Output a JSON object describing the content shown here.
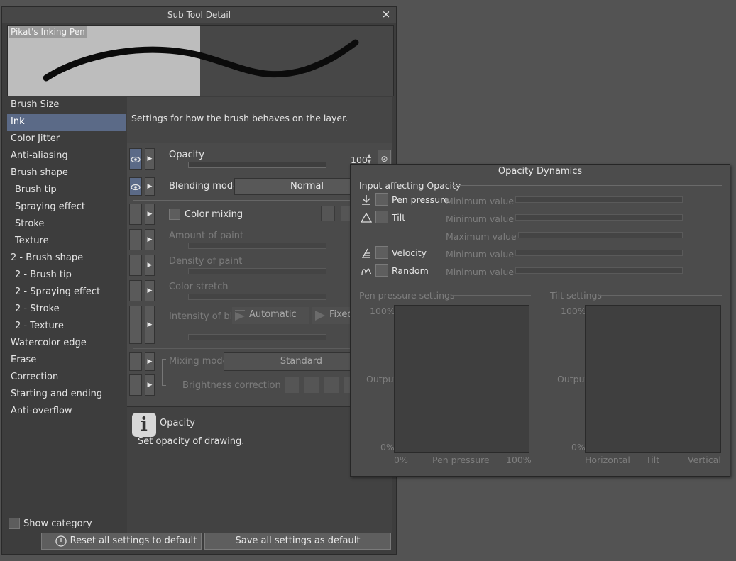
{
  "dialog": {
    "title": "Sub Tool Detail",
    "close_icon": "×",
    "preview_label": "Pikat's Inking Pen"
  },
  "categories": [
    {
      "label": "Brush Size",
      "sub": false,
      "selected": false
    },
    {
      "label": "Ink",
      "sub": false,
      "selected": true
    },
    {
      "label": "Color Jitter",
      "sub": false,
      "selected": false
    },
    {
      "label": "Anti-aliasing",
      "sub": false,
      "selected": false
    },
    {
      "label": "Brush shape",
      "sub": false,
      "selected": false
    },
    {
      "label": "Brush tip",
      "sub": true,
      "selected": false
    },
    {
      "label": "Spraying effect",
      "sub": true,
      "selected": false
    },
    {
      "label": "Stroke",
      "sub": true,
      "selected": false
    },
    {
      "label": "Texture",
      "sub": true,
      "selected": false
    },
    {
      "label": "2 - Brush shape",
      "sub": false,
      "selected": false
    },
    {
      "label": "2 - Brush tip",
      "sub": true,
      "selected": false
    },
    {
      "label": "2 - Spraying effect",
      "sub": true,
      "selected": false
    },
    {
      "label": "2 - Stroke",
      "sub": true,
      "selected": false
    },
    {
      "label": "2 - Texture",
      "sub": true,
      "selected": false
    },
    {
      "label": "Watercolor edge",
      "sub": false,
      "selected": false
    },
    {
      "label": "Erase",
      "sub": false,
      "selected": false
    },
    {
      "label": "Correction",
      "sub": false,
      "selected": false
    },
    {
      "label": "Starting and ending",
      "sub": false,
      "selected": false
    },
    {
      "label": "Anti-overflow",
      "sub": false,
      "selected": false
    }
  ],
  "show_category": "Show category",
  "settings": {
    "description": "Settings for how the brush behaves on the layer.",
    "opacity_label": "Opacity",
    "opacity_value": "100",
    "blending_mode_label": "Blending mode",
    "blending_mode_value": "Normal",
    "color_mixing_label": "Color mixing",
    "amount_of_paint_label": "Amount of paint",
    "density_of_paint_label": "Density of paint",
    "color_stretch_label": "Color stretch",
    "intensity_of_blur_label": "Intensity of blur",
    "intensity_automatic": "Automatic",
    "intensity_fixed": "Fixed",
    "mixing_mode_label": "Mixing mode",
    "mixing_mode_value": "Standard",
    "brightness_correction_label": "Brightness correction"
  },
  "help": {
    "title": "Opacity",
    "text": "Set opacity of drawing.",
    "icon": "i"
  },
  "buttons": {
    "reset": "Reset all settings to default",
    "save": "Save all settings as default"
  },
  "dynamics": {
    "title": "Opacity Dynamics",
    "section": "Input affecting Opacity",
    "inputs": {
      "pen_pressure": "Pen pressure",
      "tilt": "Tilt",
      "velocity": "Velocity",
      "random": "Random"
    },
    "minimum_value": "Minimum value",
    "maximum_value": "Maximum value",
    "pen_settings": {
      "title": "Pen pressure settings",
      "y_top": "100%",
      "y_label": "Output",
      "y_bottom": "0%",
      "x_left": "0%",
      "x_mid": "Pen pressure",
      "x_right": "100%"
    },
    "tilt_settings": {
      "title": "Tilt settings",
      "y_top": "100%",
      "y_label": "Output",
      "y_bottom": "0%",
      "x_left": "Horizontal",
      "x_mid": "Tilt",
      "x_right": "Vertical"
    }
  }
}
